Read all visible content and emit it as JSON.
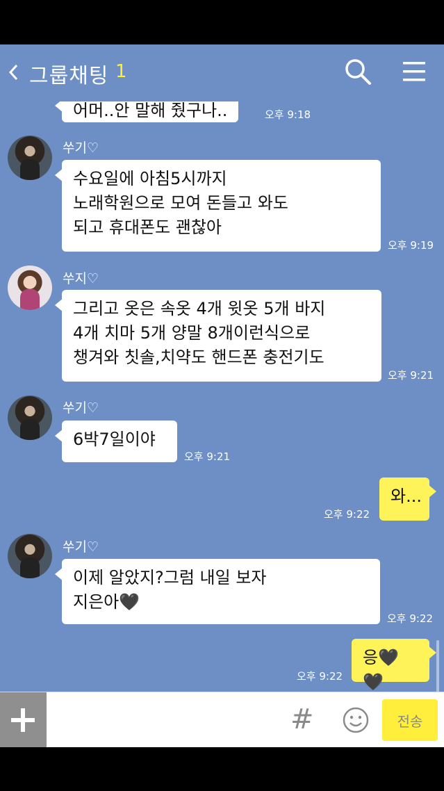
{
  "header": {
    "title": "그룹채팅",
    "member_count": "1"
  },
  "messages": [
    {
      "text": "어머..안 말해 줬구나..",
      "time": "오후 9:18"
    },
    {
      "sender": "쑤기",
      "text": "수요일에 아침5시까지\n노래학원으로 모여 돈들고 와도\n되고 휴대폰도 괜찮아",
      "time": "오후 9:19"
    },
    {
      "sender": "쑤지",
      "text": "그리고 옷은 속옷 4개 윗옷 5개 바지\n4개 치마 5개 양말 8개이런식으로\n챙겨와 칫솔,치약도 핸드폰 충전기도",
      "time": "오후 9:21"
    },
    {
      "sender": "쑤기",
      "text": "6박7일이야",
      "time": "오후 9:21"
    },
    {
      "text": "와...",
      "time": "오후 9:22"
    },
    {
      "sender": "쑤기",
      "text": "이제 알았지?그럼 내일 보자\n지은아🖤",
      "time": "오후 9:22"
    },
    {
      "text": "응🖤🖤",
      "time": "오후 9:22"
    }
  ],
  "sender_heart": "♡",
  "input": {
    "placeholder": "",
    "hash": "#",
    "send_label": "전송"
  },
  "colors": {
    "chat_background": "#6d8fc6",
    "my_bubble": "#fff35a",
    "send_button": "#ffee3b"
  }
}
